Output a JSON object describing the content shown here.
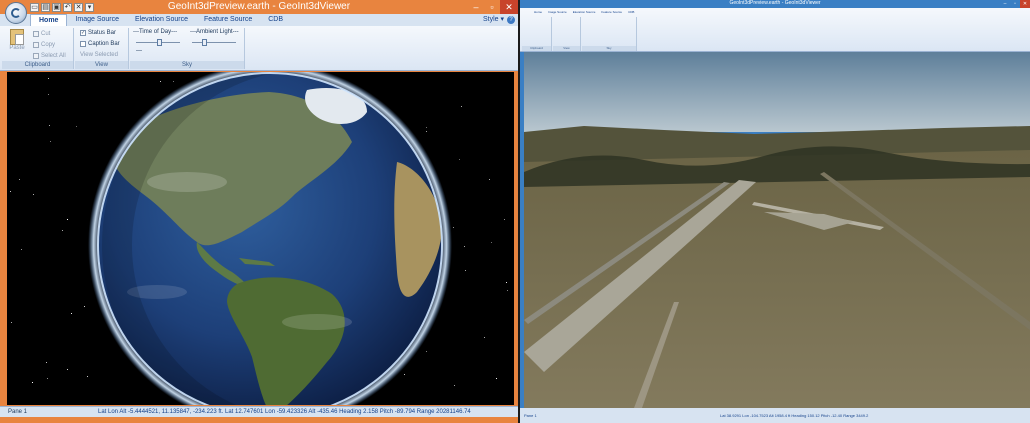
{
  "left_window": {
    "title": "GeoInt3dPreview.earth - GeoInt3dViewer",
    "window_controls": {
      "minimize": "–",
      "maximize": "▫",
      "close": "✕"
    },
    "tabs": [
      {
        "label": "Home",
        "active": true
      },
      {
        "label": "Image Source",
        "active": false
      },
      {
        "label": "Elevation Source",
        "active": false
      },
      {
        "label": "Feature Source",
        "active": false
      },
      {
        "label": "CDB",
        "active": false
      }
    ],
    "style_menu": "Style",
    "ribbon": {
      "clipboard": {
        "label": "Clipboard",
        "paste": "Paste",
        "cut": "Cut",
        "copy": "Copy",
        "select_all": "Select All"
      },
      "view": {
        "label": "View",
        "status_bar": "Status Bar",
        "status_bar_checked": true,
        "caption_bar": "Caption Bar",
        "caption_bar_checked": false,
        "view_selected": "View Selected"
      },
      "sky": {
        "label": "Sky",
        "time_of_day": "---Time of Day---",
        "ambient_light": "---Ambient Light---",
        "time_dash": "—",
        "time_of_day_level": 0.55,
        "ambient_light_level": 0.25
      }
    },
    "statusbar": {
      "pane": "Pane 1",
      "coords": "Lat Lon Alt -5.4444521, 11.135847, -234.223 ft.    Lat 12.747601 Lon -59.423326 Alt   -435.46 Heading   2.158 Pitch -89.794 Range 20281146.74"
    }
  },
  "right_window": {
    "title": "GeoInt3dPreview.earth - GeoInt3dViewer",
    "tabs": [
      "Home",
      "Image Source",
      "Elevation Source",
      "Feature Source",
      "CDB"
    ],
    "groups": [
      "Clipboard",
      "View",
      "Sky"
    ],
    "statusbar": {
      "pane": "Pane 1",
      "coords": "Lat 38.9291 Lon -104.7523 Alt 1958.4 ft   Heading 150.12  Pitch -12.40  Range 3449.2"
    }
  },
  "colors": {
    "left_title_accent": "#e8843f",
    "right_title_accent": "#3a7fc4",
    "ribbon_text": "#15428b",
    "close_button": "#c8432b"
  },
  "icons": [
    "app-orb-icon",
    "new-file-icon",
    "open-file-icon",
    "save-icon",
    "undo-icon",
    "close-doc-icon",
    "paste-icon",
    "cut-icon",
    "copy-icon",
    "select-all-icon",
    "help-icon"
  ]
}
